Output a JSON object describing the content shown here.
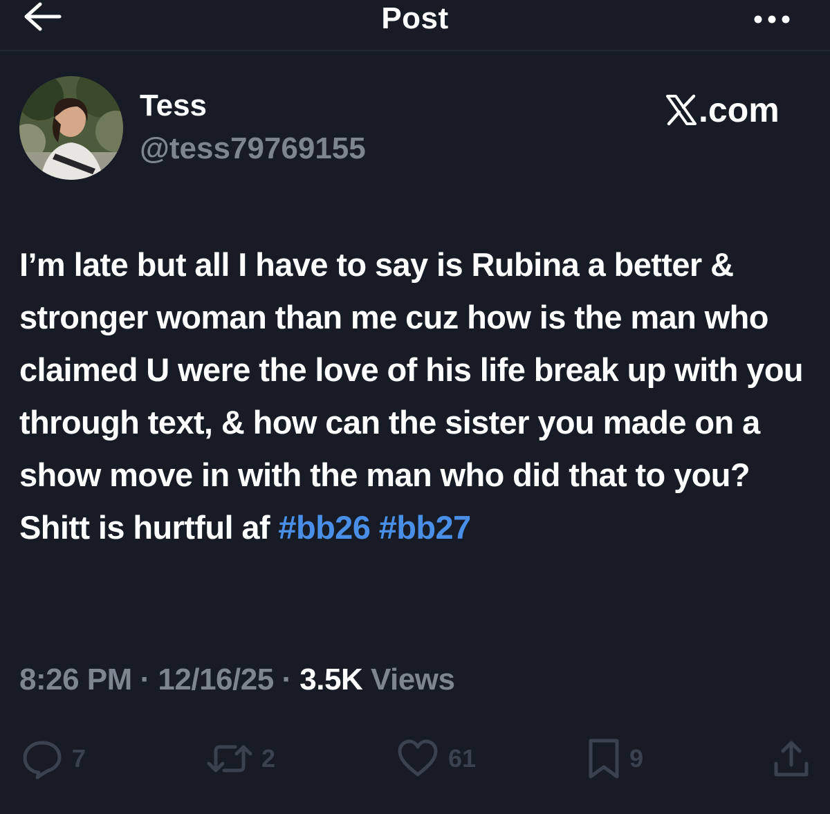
{
  "colors": {
    "background": "#161b25",
    "text_primary": "#ffffff",
    "text_secondary": "#7c8590",
    "hashtag": "#4a8fe7",
    "action_muted": "#3a4250"
  },
  "header": {
    "back_icon": "arrow-left-icon",
    "title": "Post",
    "more_icon": "more-horizontal-icon"
  },
  "author": {
    "display_name": "Tess",
    "handle": "@tess79769155",
    "avatar_icon": "profile-photo"
  },
  "source": {
    "logo": "x-logo-icon",
    "label": ".com"
  },
  "post": {
    "text_before_tags": "I’m late but all I have to say is Rubina a better & stronger woman than me cuz how is the man who claimed U were the love of his life break up with you through text, & how can the sister you made on a show move in with the man who did that to you? Shitt is hurtful af ",
    "hashtags": [
      "#bb26",
      "#bb27"
    ]
  },
  "meta": {
    "time": "8:26 PM",
    "separator": " · ",
    "date": "12/16/25",
    "views_count": "3.5K",
    "views_label": " Views"
  },
  "actions": {
    "replies": {
      "icon": "reply-icon",
      "count": "7"
    },
    "reposts": {
      "icon": "repost-icon",
      "count": "2"
    },
    "likes": {
      "icon": "heart-icon",
      "count": "61"
    },
    "bookmarks": {
      "icon": "bookmark-icon",
      "count": "9"
    },
    "share": {
      "icon": "share-icon"
    }
  }
}
